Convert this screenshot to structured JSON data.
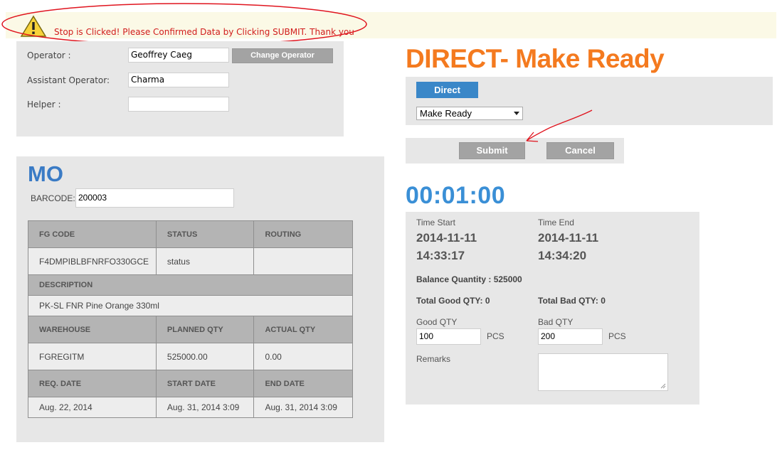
{
  "alert": {
    "message": "Stop is Clicked! Please Confirmed Data by Clicking SUBMIT. Thank you",
    "icon": "warning-icon"
  },
  "operator": {
    "operator_label": "Operator :",
    "operator_value": "Geoffrey Caeg",
    "change_operator_label": "Change Operator",
    "assistant_label": "Assistant Operator:",
    "assistant_value": "Charma",
    "helper_label": "Helper :",
    "helper_value": ""
  },
  "header": {
    "title": "DIRECT- Make Ready"
  },
  "type_panel": {
    "direct_label": "Direct",
    "mode_selected": "Make Ready"
  },
  "actions": {
    "submit_label": "Submit",
    "cancel_label": "Cancel"
  },
  "timer": "00:01:00",
  "mo": {
    "title": "MO",
    "barcode_label": "BARCODE:",
    "barcode_value": "200003",
    "table": {
      "fg_code_h": "FG CODE",
      "status_h": "STATUS",
      "routing_h": "ROUTING",
      "fg_code": "F4DMPIBLBFNRFO330GCE",
      "status": "status",
      "routing": "",
      "description_h": "DESCRIPTION",
      "description": "PK-SL FNR Pine Orange 330ml",
      "warehouse_h": "WAREHOUSE",
      "planned_qty_h": "PLANNED QTY",
      "actual_qty_h": "ACTUAL QTY",
      "warehouse": "FGREGITM",
      "planned_qty": "525000.00",
      "actual_qty": "0.00",
      "req_date_h": "REQ. DATE",
      "start_date_h": "START DATE",
      "end_date_h": "END DATE",
      "req_date": "Aug. 22, 2014",
      "start_date": "Aug. 31, 2014 3:09",
      "end_date": "Aug. 31, 2014 3:09"
    }
  },
  "stats": {
    "time_start_label": "Time Start",
    "time_start_date": "2014-11-11",
    "time_start_time": "14:33:17",
    "time_end_label": "Time End",
    "time_end_date": "2014-11-11",
    "time_end_time": "14:34:20",
    "balance_qty": "Balance Quantity : 525000",
    "total_good": "Total Good QTY: 0",
    "total_bad": "Total Bad QTY: 0",
    "good_qty_label": "Good QTY",
    "good_qty_value": "100",
    "bad_qty_label": "Bad QTY",
    "bad_qty_value": "200",
    "pcs_label": "PCS",
    "remarks_label": "Remarks",
    "remarks_value": ""
  },
  "colors": {
    "title_orange": "#f47a1f",
    "accent_blue": "#3a87c8",
    "alert_red": "#d11c1c",
    "annotation_red": "#e0141e"
  }
}
